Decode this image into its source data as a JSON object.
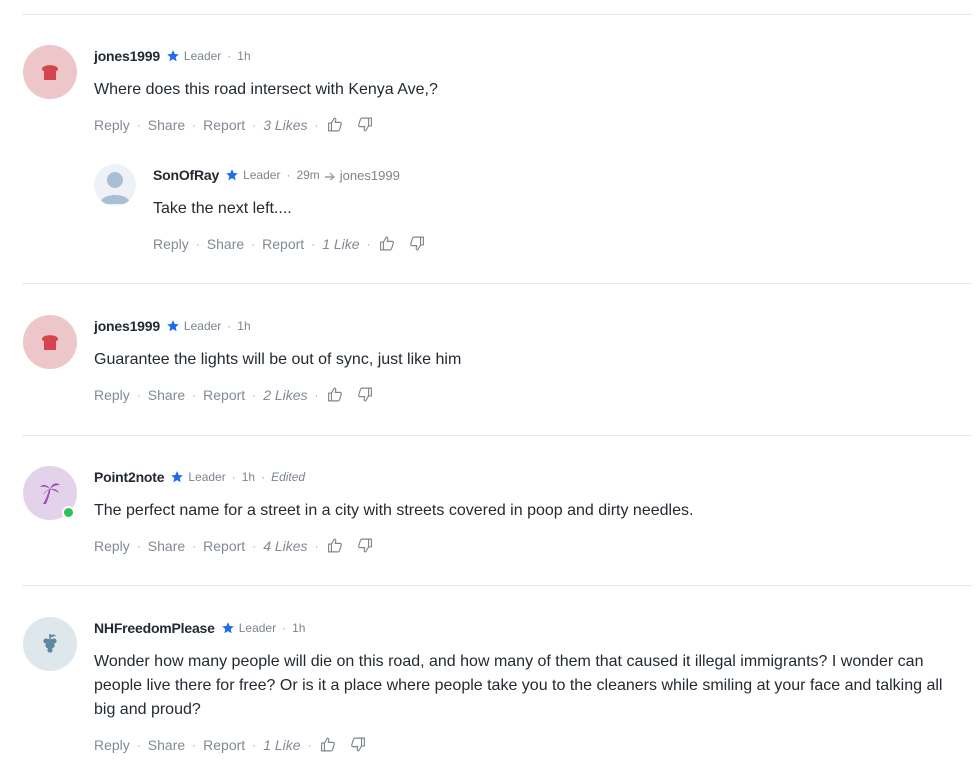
{
  "actions": {
    "reply": "Reply",
    "share": "Share",
    "report": "Report",
    "separator": "·"
  },
  "comments": [
    {
      "username": "jones1999",
      "badge": "Leader",
      "time": "1h",
      "text": "Where does this road intersect with Kenya Ave,?",
      "likes": "3 Likes",
      "avatar_icon": "bread-icon",
      "reply": {
        "username": "SonOfRay",
        "badge": "Leader",
        "time": "29m",
        "reply_to": "jones1999",
        "text": "Take the next left....",
        "likes": "1 Like",
        "avatar_icon": "user-silhouette-icon"
      }
    },
    {
      "username": "jones1999",
      "badge": "Leader",
      "time": "1h",
      "text": "Guarantee the lights will be out of sync, just like him",
      "likes": "2 Likes",
      "avatar_icon": "bread-icon"
    },
    {
      "username": "Point2note",
      "badge": "Leader",
      "time": "1h",
      "edited": "Edited",
      "text": "The perfect name for a street in a city with streets covered in poop and dirty needles.",
      "likes": "4 Likes",
      "avatar_icon": "palm-tree-icon",
      "online": true
    },
    {
      "username": "NHFreedomPlease",
      "badge": "Leader",
      "time": "1h",
      "text": "Wonder how many people will die on this road, and how many of them that caused it illegal immigrants? I wonder can people live there for free? Or is it a place where people take you to the cleaners while smiling at your face and talking all big and proud?",
      "likes": "1 Like",
      "avatar_icon": "grapes-icon"
    }
  ],
  "colors": {
    "star": "#1d6cf0",
    "online": "#2cc15b",
    "bread": "#d6454d",
    "palm": "#9b4fb4",
    "grapes": "#5d89a0"
  }
}
